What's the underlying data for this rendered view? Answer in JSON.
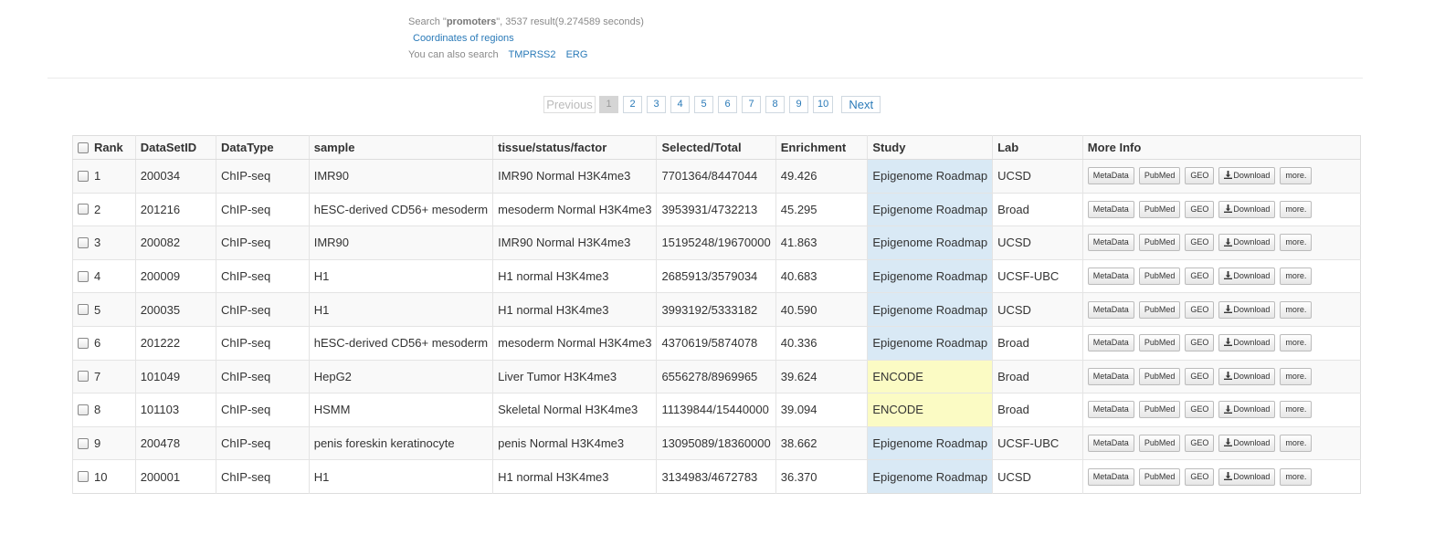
{
  "search": {
    "prefix": "Search \"",
    "term": "promoters",
    "suffix": "\", 3537 result(9.274589 seconds)",
    "coords_link": "Coordinates of regions",
    "also_label": "You can also search",
    "also_links": [
      "TMPRSS2",
      "ERG"
    ]
  },
  "pagination": {
    "previous": "Previous",
    "pages": [
      "1",
      "2",
      "3",
      "4",
      "5",
      "6",
      "7",
      "8",
      "9",
      "10"
    ],
    "next": "Next",
    "active": "1"
  },
  "table": {
    "headers": [
      "Rank",
      "DataSetID",
      "DataType",
      "sample",
      "tissue/status/factor",
      "Selected/Total",
      "Enrichment",
      "Study",
      "Lab",
      "More Info"
    ],
    "buttons": [
      "MetaData",
      "PubMed",
      "GEO",
      "Download",
      "more."
    ],
    "rows": [
      {
        "rank": "1",
        "id": "200034",
        "type": "ChIP-seq",
        "sample": "IMR90",
        "tissue": "IMR90 Normal H3K4me3",
        "sel": "7701364/8447044",
        "enr": "49.426",
        "study": "Epigenome Roadmap",
        "lab": "UCSD"
      },
      {
        "rank": "2",
        "id": "201216",
        "type": "ChIP-seq",
        "sample": "hESC-derived CD56+ mesoderm",
        "tissue": "mesoderm Normal H3K4me3",
        "sel": "3953931/4732213",
        "enr": "45.295",
        "study": "Epigenome Roadmap",
        "lab": "Broad"
      },
      {
        "rank": "3",
        "id": "200082",
        "type": "ChIP-seq",
        "sample": "IMR90",
        "tissue": "IMR90 Normal H3K4me3",
        "sel": "15195248/19670000",
        "enr": "41.863",
        "study": "Epigenome Roadmap",
        "lab": "UCSD"
      },
      {
        "rank": "4",
        "id": "200009",
        "type": "ChIP-seq",
        "sample": "H1",
        "tissue": "H1 normal H3K4me3",
        "sel": "2685913/3579034",
        "enr": "40.683",
        "study": "Epigenome Roadmap",
        "lab": "UCSF-UBC"
      },
      {
        "rank": "5",
        "id": "200035",
        "type": "ChIP-seq",
        "sample": "H1",
        "tissue": "H1 normal H3K4me3",
        "sel": "3993192/5333182",
        "enr": "40.590",
        "study": "Epigenome Roadmap",
        "lab": "UCSD"
      },
      {
        "rank": "6",
        "id": "201222",
        "type": "ChIP-seq",
        "sample": "hESC-derived CD56+ mesoderm",
        "tissue": "mesoderm Normal H3K4me3",
        "sel": "4370619/5874078",
        "enr": "40.336",
        "study": "Epigenome Roadmap",
        "lab": "Broad"
      },
      {
        "rank": "7",
        "id": "101049",
        "type": "ChIP-seq",
        "sample": "HepG2",
        "tissue": "Liver Tumor H3K4me3",
        "sel": "6556278/8969965",
        "enr": "39.624",
        "study": "ENCODE",
        "lab": "Broad"
      },
      {
        "rank": "8",
        "id": "101103",
        "type": "ChIP-seq",
        "sample": "HSMM",
        "tissue": "Skeletal Normal H3K4me3",
        "sel": "11139844/15440000",
        "enr": "39.094",
        "study": "ENCODE",
        "lab": "Broad"
      },
      {
        "rank": "9",
        "id": "200478",
        "type": "ChIP-seq",
        "sample": "penis foreskin keratinocyte",
        "tissue": "penis Normal H3K4me3",
        "sel": "13095089/18360000",
        "enr": "38.662",
        "study": "Epigenome Roadmap",
        "lab": "UCSF-UBC"
      },
      {
        "rank": "10",
        "id": "200001",
        "type": "ChIP-seq",
        "sample": "H1",
        "tissue": "H1 normal H3K4me3",
        "sel": "3134983/4672783",
        "enr": "36.370",
        "study": "Epigenome Roadmap",
        "lab": "UCSD"
      }
    ]
  },
  "colors": {
    "link": "#2a7ab8",
    "epigenome_cell": "#d9e9f5",
    "encode_cell": "#fbfbc4",
    "active_page": "#d5d5d5"
  }
}
